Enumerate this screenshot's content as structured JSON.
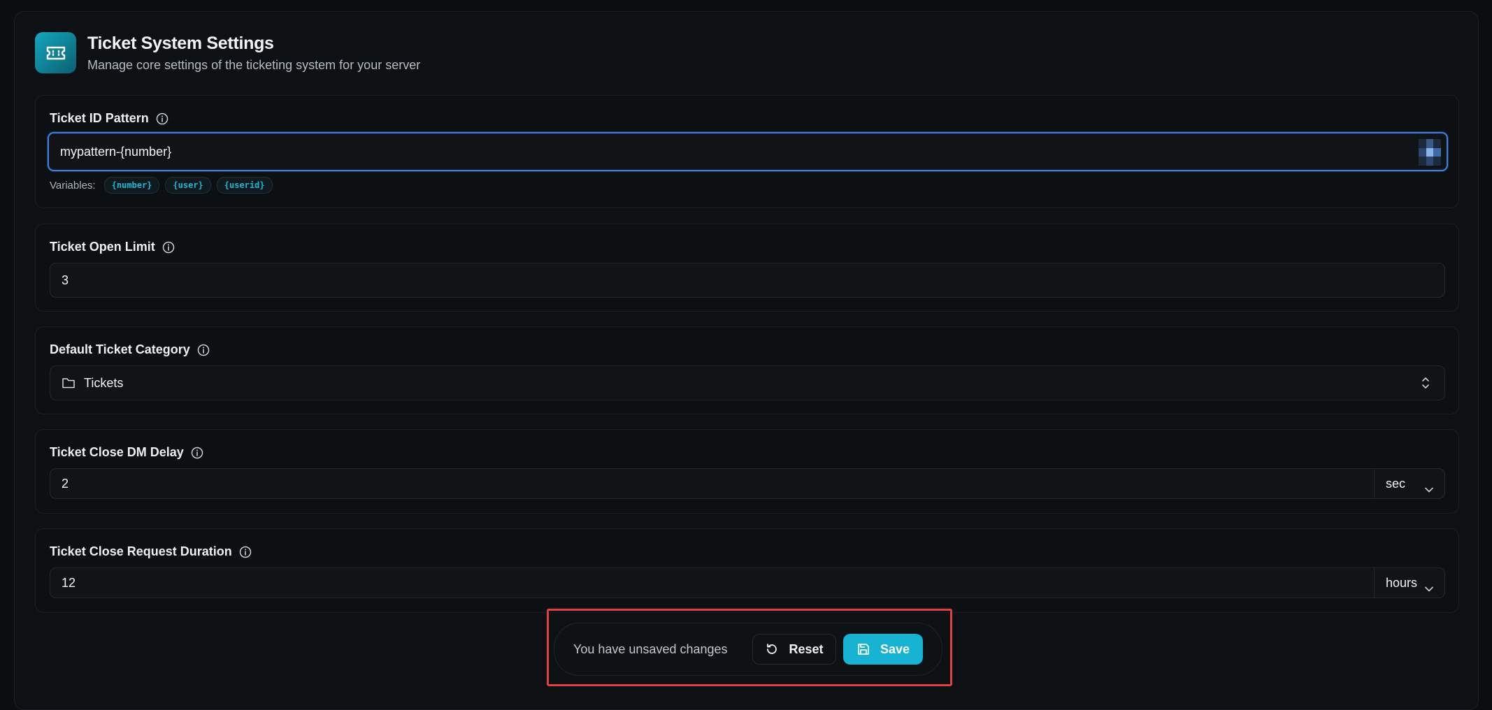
{
  "header": {
    "icon": "ticket-icon",
    "title": "Ticket System Settings",
    "subtitle": "Manage core settings of the ticketing system for your server"
  },
  "fields": {
    "id_pattern": {
      "label": "Ticket ID Pattern",
      "value": "mypattern-{number}",
      "variables_label": "Variables:",
      "variables": [
        "{number}",
        "{user}",
        "{userid}"
      ]
    },
    "open_limit": {
      "label": "Ticket Open Limit",
      "value": "3"
    },
    "default_category": {
      "label": "Default Ticket Category",
      "value": "Tickets",
      "icon": "folder-icon"
    },
    "close_dm_delay": {
      "label": "Ticket Close DM Delay",
      "value": "2",
      "unit": "sec"
    },
    "close_request_duration": {
      "label": "Ticket Close Request Duration",
      "value": "12",
      "unit": "hours"
    }
  },
  "save_bar": {
    "message": "You have unsaved changes",
    "reset_label": "Reset",
    "save_label": "Save"
  },
  "colors": {
    "accent": "#17b3d3",
    "focus": "#3b7de0",
    "highlight_outline": "#e0403f"
  }
}
